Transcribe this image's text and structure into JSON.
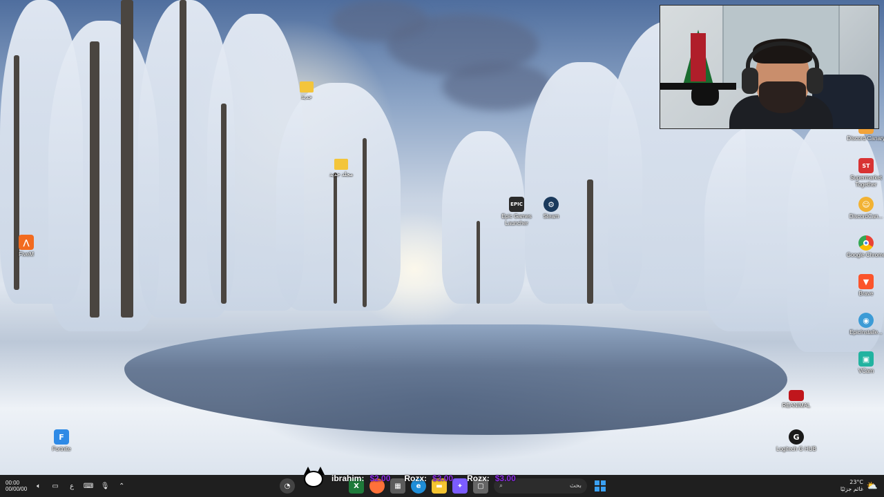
{
  "desktop": {
    "icons": [
      {
        "label": "جديد",
        "icon": "folder-icon",
        "color": "#f3c53b"
      },
      {
        "label": "مجلد جديد",
        "icon": "folder-icon",
        "color": "#f3c53b"
      },
      {
        "label": "FiveM",
        "icon": "fivem-icon",
        "color": "#f26b1f"
      },
      {
        "label": "Epic Games Launcher",
        "icon": "epic-games-icon",
        "color": "#2b2b2b"
      },
      {
        "label": "Steam",
        "icon": "steam-icon",
        "color": "#1b3a5c"
      },
      {
        "label": "Fortnite",
        "icon": "fortnite-icon",
        "color": "#2e8ae6"
      },
      {
        "label": "Discord Canary",
        "icon": "discord-canary-icon",
        "color": "#f2a33a"
      },
      {
        "label": "Supermarket Together",
        "icon": "supermarket-icon",
        "color": "#d83333"
      },
      {
        "label": "DiscordCan...",
        "icon": "discord-icon",
        "color": "#f2b233"
      },
      {
        "label": "Google Chrome",
        "icon": "chrome-icon",
        "color": "#e94235"
      },
      {
        "label": "Brave",
        "icon": "brave-icon",
        "color": "#fb542b"
      },
      {
        "label": "EpicInstalle...",
        "icon": "installer-icon",
        "color": "#3c9bd6"
      },
      {
        "label": "VCam",
        "icon": "vcam-icon",
        "color": "#21b3a0"
      },
      {
        "label": "REANIMAL",
        "icon": "reanimal-icon",
        "color": "#c0161c"
      },
      {
        "label": "Logitech G HUB",
        "icon": "logitech-icon",
        "color": "#1a1a1a"
      }
    ]
  },
  "webcam": {
    "label": "webcam overlay"
  },
  "chat": {
    "avatar_icon": "cat-avatar-icon",
    "messages": [
      {
        "user": "ibrahim:",
        "amount": "$2.00"
      },
      {
        "user": "Rozx:",
        "amount": "$3.00"
      },
      {
        "user": "Rozx:",
        "amount": "$3.00"
      }
    ]
  },
  "taskbar": {
    "clock_time": "00:00",
    "clock_date": "00/00/00",
    "language": "ع",
    "search_placeholder": "بحث",
    "weather_temp": "23°C",
    "weather_desc": "غائم جزئيًا",
    "apps": [
      {
        "name": "task-view-icon",
        "color": "#444"
      },
      {
        "name": "widgets-icon",
        "color": "#1e7a3a"
      },
      {
        "name": "firefox-icon",
        "color": "#ff7139"
      },
      {
        "name": "store-icon",
        "color": "#5c5c5c"
      },
      {
        "name": "edge-icon",
        "color": "#1f8ed8"
      },
      {
        "name": "file-explorer-icon",
        "color": "#f4c430"
      },
      {
        "name": "copilot-icon",
        "color": "#7b5cff"
      },
      {
        "name": "app-icon",
        "color": "#666"
      }
    ]
  }
}
